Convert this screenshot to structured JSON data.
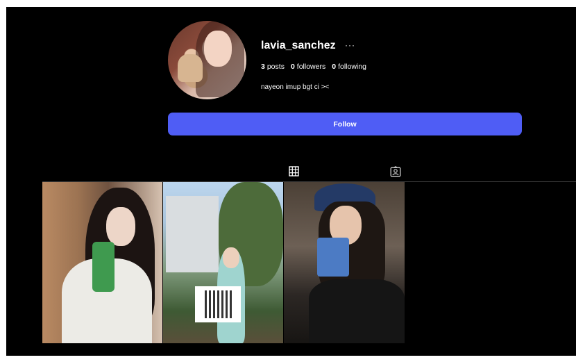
{
  "profile": {
    "username": "lavia_sanchez",
    "more_icon": "more-horizontal-icon",
    "more_glyph": "···",
    "stats": {
      "posts_count": "3",
      "posts_label": "posts",
      "followers_count": "0",
      "followers_label": "followers",
      "following_count": "0",
      "following_label": "following"
    },
    "bio": "nayeon imup bgt ci ><"
  },
  "actions": {
    "follow_label": "Follow"
  },
  "tabs": [
    {
      "name": "posts-grid",
      "icon": "grid-icon",
      "active": true
    },
    {
      "name": "tagged",
      "icon": "tagged-user-icon",
      "active": false
    }
  ],
  "colors": {
    "background": "#000000",
    "accent": "#4f5df5",
    "text": "#ffffff"
  }
}
